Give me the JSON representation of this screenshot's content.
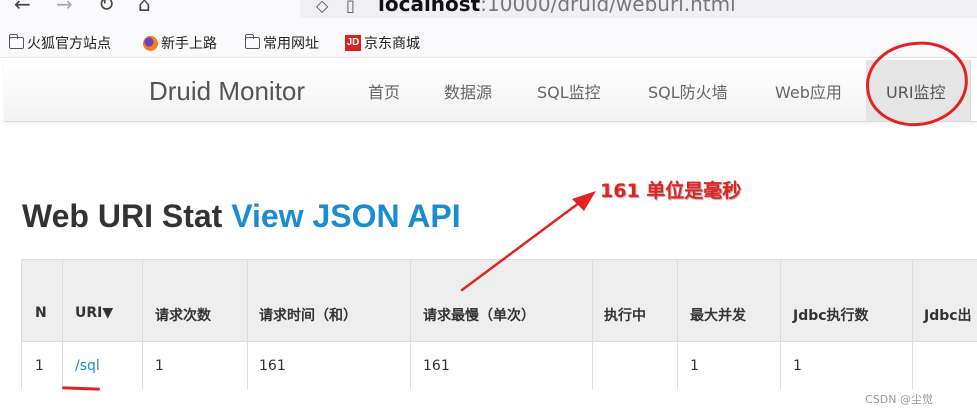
{
  "browser": {
    "url_host": "localhost",
    "url_rest": ":10000/druid/weburi.html",
    "nav_icons": {
      "back": "←",
      "forward": "→",
      "reload": "↻",
      "home": "⌂"
    }
  },
  "bookmarks": [
    {
      "icon": "folder-icon",
      "label": "火狐官方站点"
    },
    {
      "icon": "firefox-icon",
      "label": "新手上路"
    },
    {
      "icon": "folder-icon",
      "label": "常用网址"
    },
    {
      "icon": "jd-icon",
      "label": "京东商城",
      "icon_text": "JD"
    }
  ],
  "navbar": {
    "brand": "Druid Monitor",
    "links": [
      "首页",
      "数据源",
      "SQL监控",
      "SQL防火墙",
      "Web应用",
      "URI监控"
    ],
    "active_index": 5
  },
  "page": {
    "title": "Web URI Stat",
    "api_link": "View JSON API"
  },
  "table": {
    "headers": [
      "N",
      "URI▼",
      "请求次数",
      "请求时间（和）",
      "请求最慢（单次）",
      "执行中",
      "最大并发",
      "Jdbc执行数",
      "Jdbc出"
    ],
    "rows": [
      [
        "1",
        "/sql",
        "1",
        "161",
        "161",
        "",
        "1",
        "1",
        ""
      ]
    ]
  },
  "annotation": {
    "text": "161 单位是毫秒",
    "color": "#e32222"
  },
  "watermark": "CSDN @尘觉",
  "colors": {
    "link": "#1d8bcf",
    "header_bg": "#eeeeee"
  }
}
